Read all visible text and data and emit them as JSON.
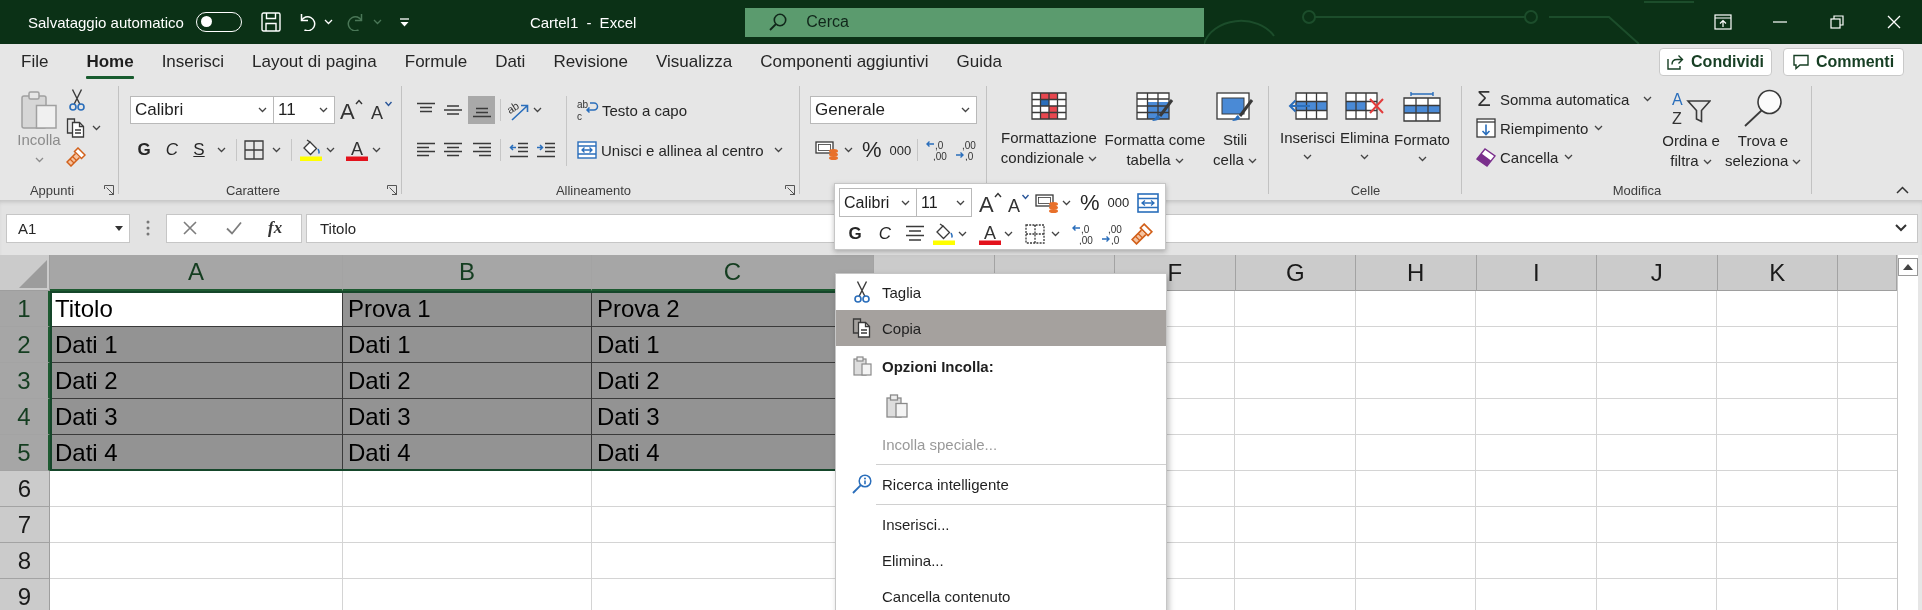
{
  "title_bar": {
    "autosave": {
      "label": "Salvataggio automatico",
      "on": false
    },
    "redo": {
      "disabled": true
    },
    "title": "Cartel1 - Excel",
    "search": {
      "placeholder": "Cerca"
    }
  },
  "tabs": [
    {
      "label": "File",
      "selected": false
    },
    {
      "label": "Home",
      "selected": true
    },
    {
      "label": "Inserisci",
      "selected": false
    },
    {
      "label": "Layout di pagina",
      "selected": false
    },
    {
      "label": "Formule",
      "selected": false
    },
    {
      "label": "Dati",
      "selected": false
    },
    {
      "label": "Revisione",
      "selected": false
    },
    {
      "label": "Visualizza",
      "selected": false
    },
    {
      "label": "Componenti aggiuntivi",
      "selected": false
    },
    {
      "label": "Guida",
      "selected": false
    }
  ],
  "share_buttons": [
    {
      "kind": "share",
      "label": "Condividi"
    },
    {
      "kind": "comments",
      "label": "Commenti"
    }
  ],
  "ribbon": {
    "clipboard": {
      "label": "Appunti",
      "paste": {
        "label": "Incolla",
        "disabled": true
      }
    },
    "font": {
      "label": "Carattere",
      "font_name": "Calibri",
      "font_size": "11",
      "grow": "A",
      "shrink": "A",
      "bold": "G",
      "italic": "C",
      "underline": "S",
      "font_color": "A"
    },
    "alignment": {
      "label": "Allineamento",
      "vertical": [
        {
          "kind": "top",
          "selected": false
        },
        {
          "kind": "middle",
          "selected": false
        },
        {
          "kind": "bottom",
          "selected": true
        }
      ],
      "orientation": "ab",
      "wrap_text": {
        "icon": [
          "ab",
          "c"
        ],
        "label": "Testo a capo"
      },
      "merge": "Unisci e allinea al centro"
    },
    "number": {
      "format": "Generale",
      "percent": "%",
      "thousands": "000",
      "increase_decimal": [
        ",0",
        ",00"
      ],
      "decrease_decimal": [
        ",00",
        ",0"
      ]
    },
    "styles": [
      {
        "kind": "conditional",
        "lines": [
          "Formattazione",
          "condizionale"
        ]
      },
      {
        "kind": "table",
        "lines": [
          "Formatta come",
          "tabella"
        ]
      },
      {
        "kind": "cell",
        "lines": [
          "Stili",
          "cella"
        ]
      }
    ],
    "cells": {
      "label": "Celle",
      "buttons": [
        {
          "kind": "insert",
          "label": "Inserisci"
        },
        {
          "kind": "delete",
          "label": "Elimina"
        },
        {
          "kind": "format",
          "label": "Formato"
        }
      ]
    },
    "editing": {
      "label": "Modifica",
      "autosum": {
        "symbol": "Σ",
        "label": "Somma automatica"
      },
      "fill": "Riempimento",
      "clear": "Cancella",
      "sort": {
        "icon": [
          "A",
          "Z"
        ],
        "lines": [
          "Ordina e",
          "filtra"
        ]
      },
      "find": {
        "lines": [
          "Trova e",
          "seleziona"
        ]
      }
    }
  },
  "mini_toolbar": {
    "font_name": "Calibri",
    "font_size": "11",
    "grow": "A",
    "shrink": "A",
    "percent": "%",
    "thousands": "000",
    "bold": "G",
    "italic": "C",
    "font_color": "A",
    "increase_decimal": [
      ",0",
      ",00"
    ],
    "decrease_decimal": [
      ",00",
      ",0"
    ]
  },
  "formula_bar": {
    "name_box": "A1",
    "function_button": "fx",
    "formula": "Titolo"
  },
  "grid": {
    "columns": [
      {
        "label": "A",
        "selected": true
      },
      {
        "label": "B",
        "selected": true
      },
      {
        "label": "C",
        "selected": true
      },
      {
        "selected": false
      },
      {
        "selected": false
      },
      {
        "label": "F",
        "selected": false
      },
      {
        "label": "G",
        "selected": false
      },
      {
        "label": "H",
        "selected": false
      },
      {
        "label": "I",
        "selected": false
      },
      {
        "label": "J",
        "selected": false
      },
      {
        "label": "K",
        "selected": false
      }
    ],
    "rows": [
      {
        "label": "1",
        "selected": true,
        "cells": [
          {
            "text": "Titolo",
            "active": true
          },
          {
            "text": "Prova 1",
            "active": false
          },
          {
            "text": "Prova 2",
            "active": false
          }
        ]
      },
      {
        "label": "2",
        "selected": true,
        "cells": [
          {
            "text": "Dati 1",
            "active": false
          },
          {
            "text": "Dati 1",
            "active": false
          },
          {
            "text": "Dati 1",
            "active": false
          }
        ]
      },
      {
        "label": "3",
        "selected": true,
        "cells": [
          {
            "text": "Dati 2",
            "active": false
          },
          {
            "text": "Dati 2",
            "active": false
          },
          {
            "text": "Dati 2",
            "active": false
          }
        ]
      },
      {
        "label": "4",
        "selected": true,
        "cells": [
          {
            "text": "Dati 3",
            "active": false
          },
          {
            "text": "Dati 3",
            "active": false
          },
          {
            "text": "Dati 3",
            "active": false
          }
        ]
      },
      {
        "label": "5",
        "selected": true,
        "cells": [
          {
            "text": "Dati 4",
            "active": false
          },
          {
            "text": "Dati 4",
            "active": false
          },
          {
            "text": "Dati 4",
            "active": false
          }
        ]
      },
      {
        "label": "6",
        "selected": false
      },
      {
        "label": "7",
        "selected": false
      },
      {
        "label": "8",
        "selected": false
      },
      {
        "label": "9",
        "selected": false
      }
    ]
  },
  "context_menu": {
    "items": [
      {
        "kind": "cut",
        "label": "Taglia",
        "selected": false,
        "disabled": false
      },
      {
        "kind": "copy",
        "label": "Copia",
        "selected": true,
        "disabled": false
      },
      {
        "kind": "header",
        "label": "Opzioni Incolla:"
      },
      {
        "kind": "paste"
      },
      {
        "kind": "command",
        "label": "Incolla speciale...",
        "selected": false,
        "disabled": true
      },
      {
        "kind": "separator"
      },
      {
        "kind": "lookup",
        "label": "Ricerca intelligente",
        "selected": false,
        "disabled": false
      },
      {
        "kind": "separator"
      },
      {
        "kind": "command",
        "label": "Inserisci...",
        "selected": false,
        "disabled": false
      },
      {
        "kind": "command",
        "label": "Elimina...",
        "selected": false,
        "disabled": false
      },
      {
        "kind": "command",
        "label": "Cancella contenuto",
        "selected": false,
        "disabled": false
      }
    ]
  }
}
